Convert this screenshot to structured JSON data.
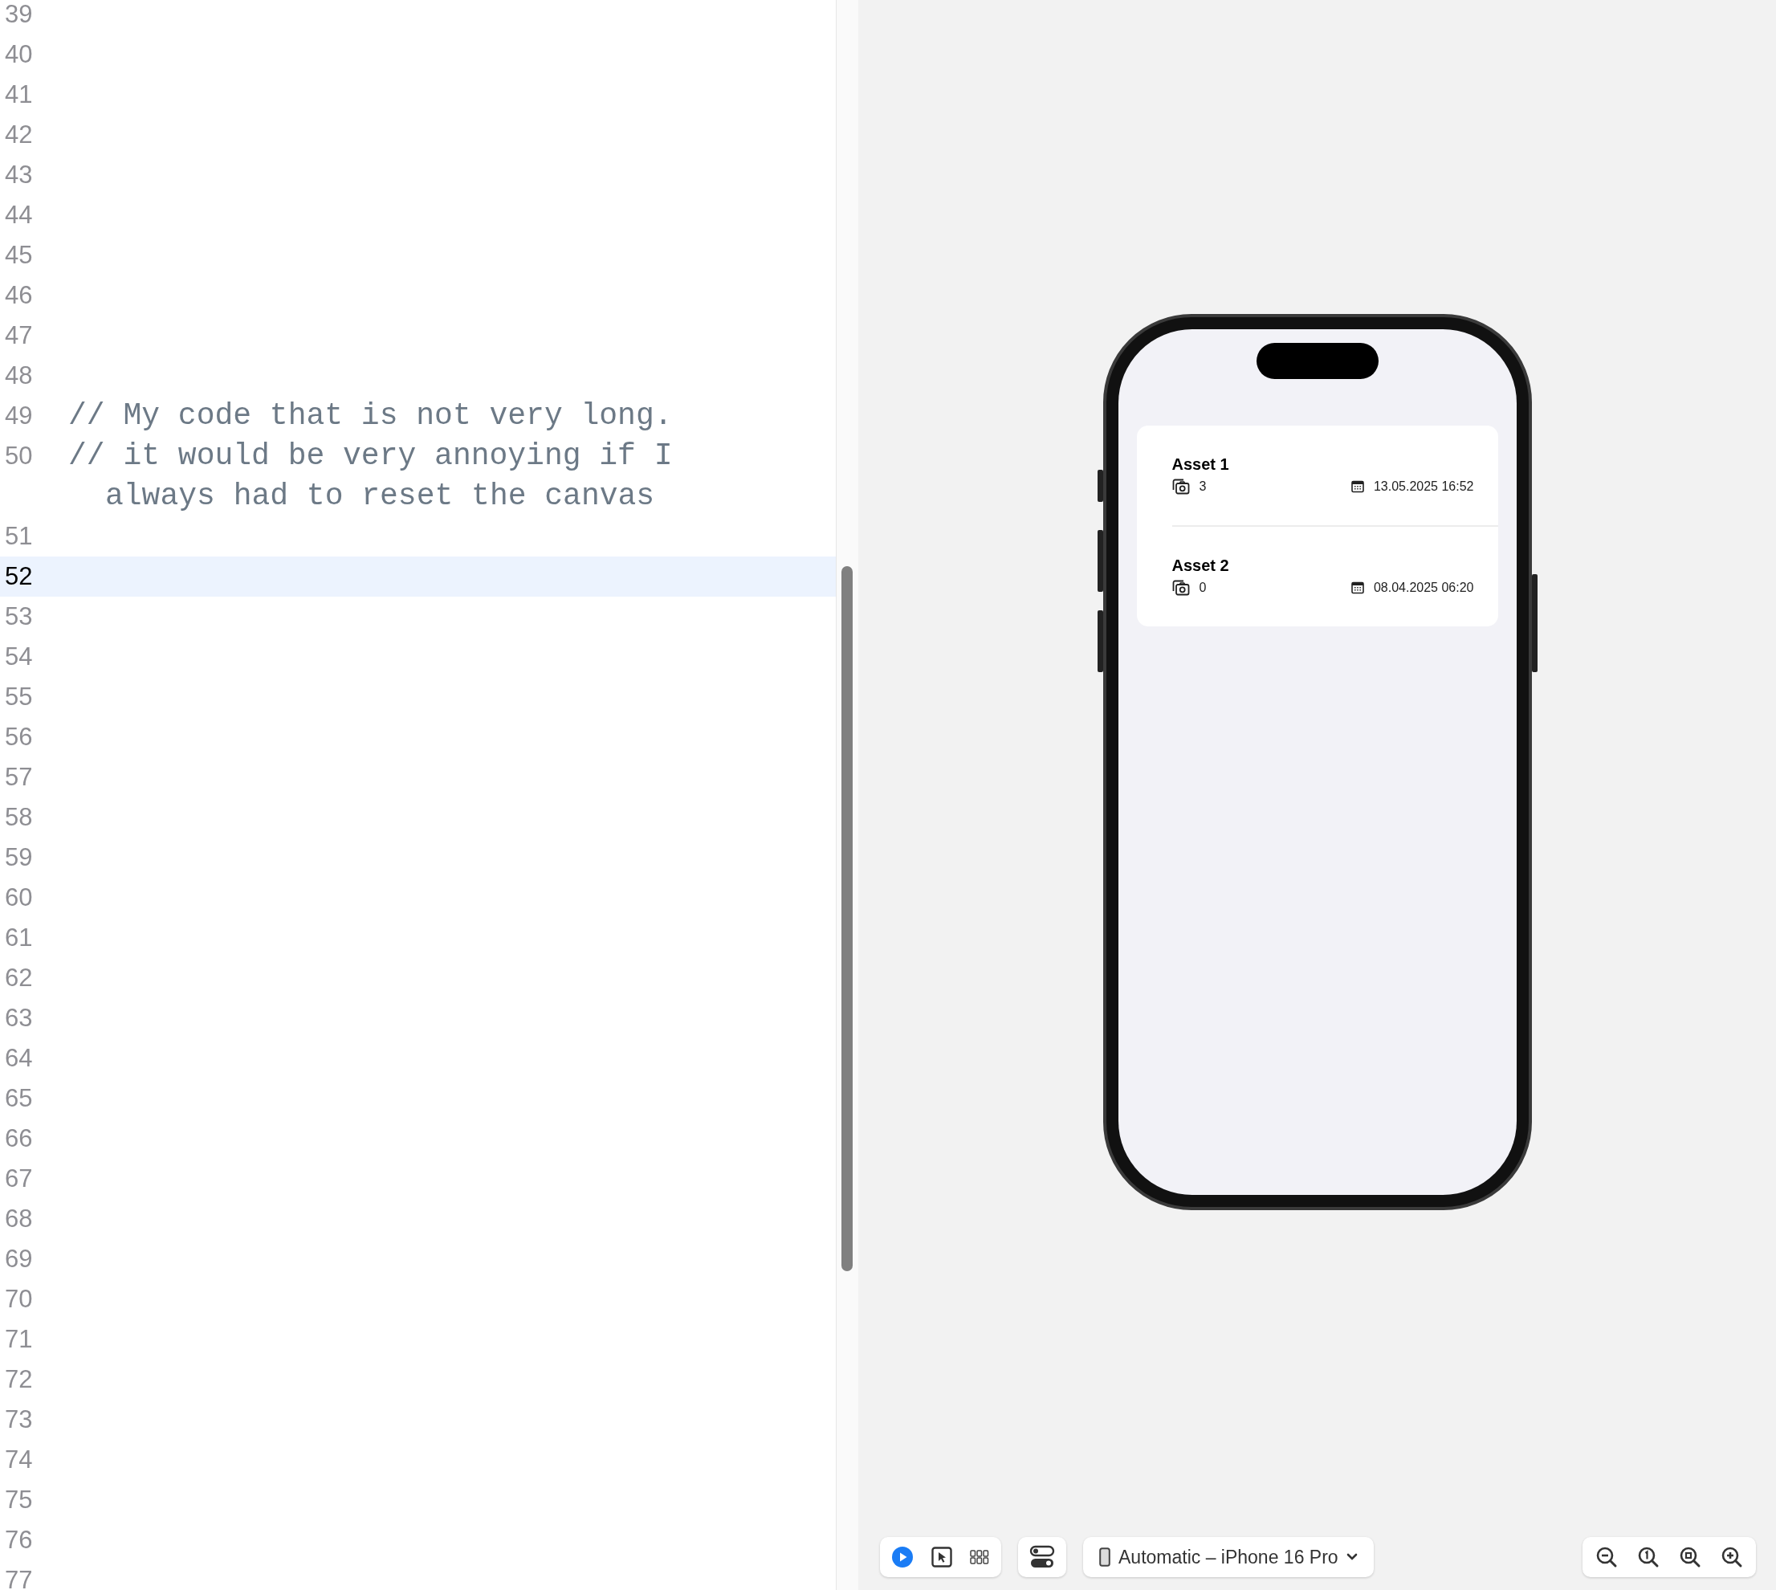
{
  "editor": {
    "lines": [
      {
        "number": "39",
        "selected": false
      },
      {
        "number": "40",
        "selected": false
      },
      {
        "number": "41",
        "selected": false
      },
      {
        "number": "42",
        "selected": false
      },
      {
        "number": "43",
        "selected": false
      },
      {
        "number": "44",
        "selected": false
      },
      {
        "number": "45",
        "selected": false
      },
      {
        "number": "46",
        "selected": false
      },
      {
        "number": "47",
        "selected": false
      },
      {
        "number": "48",
        "selected": false
      },
      {
        "number": "49",
        "text": "// My code that is not very long.",
        "selected": false
      },
      {
        "number": "50",
        "text": "// it would be very annoying if I always had to reset the canvas",
        "selected": false
      },
      {
        "number": "51",
        "selected": false
      },
      {
        "number": "52",
        "selected": true
      },
      {
        "number": "53",
        "selected": false
      },
      {
        "number": "54",
        "selected": false
      },
      {
        "number": "55",
        "selected": false
      },
      {
        "number": "56",
        "selected": false
      },
      {
        "number": "57",
        "selected": false
      },
      {
        "number": "58",
        "selected": false
      },
      {
        "number": "59",
        "selected": false
      },
      {
        "number": "60",
        "selected": false
      },
      {
        "number": "61",
        "selected": false
      },
      {
        "number": "62",
        "selected": false
      },
      {
        "number": "63",
        "selected": false
      },
      {
        "number": "64",
        "selected": false
      },
      {
        "number": "65",
        "selected": false
      },
      {
        "number": "66",
        "selected": false
      },
      {
        "number": "67",
        "selected": false
      },
      {
        "number": "68",
        "selected": false
      },
      {
        "number": "69",
        "selected": false
      },
      {
        "number": "70",
        "selected": false
      },
      {
        "number": "71",
        "selected": false
      },
      {
        "number": "72",
        "selected": false
      },
      {
        "number": "73",
        "selected": false
      },
      {
        "number": "74",
        "selected": false
      },
      {
        "number": "75",
        "selected": false
      },
      {
        "number": "76",
        "selected": false
      },
      {
        "number": "77",
        "selected": false
      }
    ]
  },
  "preview": {
    "assets": [
      {
        "title": "Asset 1",
        "photo_count": "3",
        "date": "13.05.2025 16:52"
      },
      {
        "title": "Asset 2",
        "photo_count": "0",
        "date": "08.04.2025 06:20"
      }
    ]
  },
  "toolbar": {
    "modes": [
      {
        "kind": "live",
        "selected": true
      },
      {
        "kind": "select",
        "selected": false
      },
      {
        "kind": "variants",
        "selected": false
      }
    ],
    "device": "Automatic – iPhone 16 Pro"
  }
}
